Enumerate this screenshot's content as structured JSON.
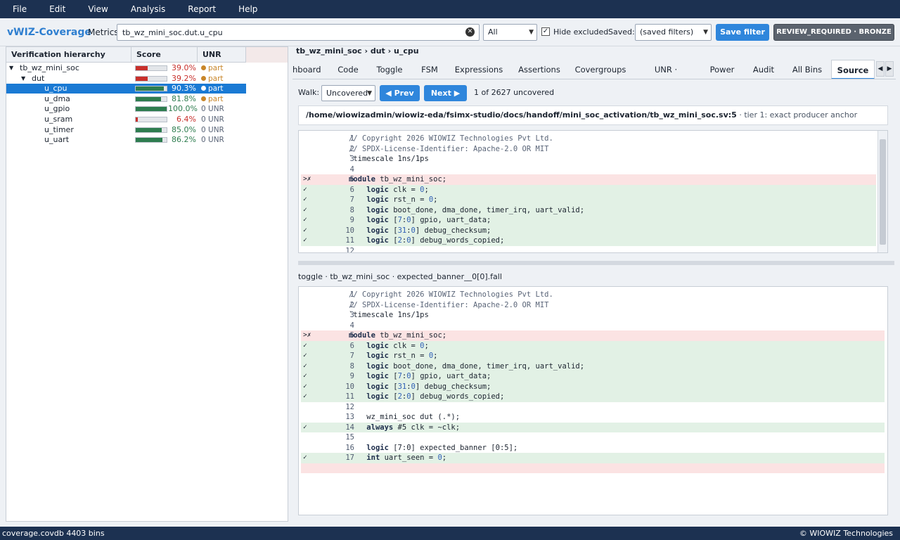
{
  "menu": [
    "File",
    "Edit",
    "View",
    "Analysis",
    "Report",
    "Help"
  ],
  "toolbar": {
    "brand": "vWIZ-Coverage",
    "metrics_label": "Metrics",
    "search_value": "tb_wz_mini_soc.dut.u_cpu",
    "scope_select": "All",
    "hide_excluded_label": "Hide excluded",
    "hide_excluded_checked": "✓",
    "saved_label": "Saved:",
    "saved_select": "(saved filters)",
    "save_filter": "Save filter",
    "status": "REVIEW_REQUIRED · BRONZE"
  },
  "tree": {
    "headers": [
      "Verification hierarchy",
      "Score",
      "UNR"
    ],
    "rows": [
      {
        "name": "tb_wz_mini_soc",
        "pct": "39.0%",
        "value": 0.39,
        "unr": "part",
        "status": "partial"
      },
      {
        "name": "dut",
        "pct": "39.2%",
        "value": 0.392,
        "unr": "part",
        "status": "partial"
      },
      {
        "name": "u_cpu",
        "pct": "90.3%",
        "value": 0.903,
        "unr": "part",
        "status": "partial",
        "selected": true
      },
      {
        "name": "u_dma",
        "pct": "81.8%",
        "value": 0.818,
        "unr": "part",
        "status": "partial"
      },
      {
        "name": "u_gpio",
        "pct": "100.0%",
        "value": 1.0,
        "unr": "0 UNR",
        "status": "none"
      },
      {
        "name": "u_sram",
        "pct": "6.4%",
        "value": 0.064,
        "unr": "0 UNR",
        "status": "none"
      },
      {
        "name": "u_timer",
        "pct": "85.0%",
        "value": 0.85,
        "unr": "0 UNR",
        "status": "none"
      },
      {
        "name": "u_uart",
        "pct": "86.2%",
        "value": 0.862,
        "unr": "0 UNR",
        "status": "none"
      }
    ]
  },
  "breadcrumb": "tb_wz_mini_soc › dut › u_cpu",
  "tabs": [
    "hboard",
    "Code",
    "Toggle",
    "FSM",
    "Expressions",
    "Assertions",
    "Covergroups",
    "UNR · Closure",
    "Power",
    "Audit",
    "All Bins",
    "Source"
  ],
  "active_tab": "Source",
  "walk": {
    "label": "Walk:",
    "mode": "Uncovered",
    "prev": "◀ Prev",
    "next": "Next ▶",
    "count": "1 of 2627 uncovered"
  },
  "source_path": "/home/wiowizadmin/wiowiz-eda/fsimx-studio/docs/handoff/mini_soc_activation/tb_wz_mini_soc.sv:5",
  "source_anchor": " · tier 1: exact producer anchor",
  "lower_title": "toggle · tb_wz_mini_soc · expected_banner__0[0].fall",
  "code_lines": [
    {
      "n": "1",
      "mark": "",
      "status": "none",
      "parts": [
        [
          "cmt",
          "// Copyright 2026 WIOWIZ Technologies Pvt Ltd."
        ]
      ]
    },
    {
      "n": "2",
      "mark": "",
      "status": "none",
      "parts": [
        [
          "cmt",
          "// SPDX-License-Identifier: Apache-2.0 OR MIT"
        ]
      ]
    },
    {
      "n": "3",
      "mark": "",
      "status": "none",
      "parts": [
        [
          "",
          "`timescale 1ns/1ps"
        ]
      ]
    },
    {
      "n": "4",
      "mark": "",
      "status": "none",
      "parts": [
        [
          "",
          ""
        ]
      ]
    },
    {
      "n": "5",
      "mark": ">✗",
      "status": "miss",
      "parts": [
        [
          "kw",
          "module"
        ],
        [
          "",
          " tb_wz_mini_soc;"
        ]
      ]
    },
    {
      "n": "6",
      "mark": "✓",
      "status": "hit",
      "parts": [
        [
          "",
          "    "
        ],
        [
          "kw",
          "logic"
        ],
        [
          "",
          " clk = "
        ],
        [
          "num",
          "0"
        ],
        [
          "",
          ";"
        ]
      ]
    },
    {
      "n": "7",
      "mark": "✓",
      "status": "hit",
      "parts": [
        [
          "",
          "    "
        ],
        [
          "kw",
          "logic"
        ],
        [
          "",
          " rst_n = "
        ],
        [
          "num",
          "0"
        ],
        [
          "",
          ";"
        ]
      ]
    },
    {
      "n": "8",
      "mark": "✓",
      "status": "hit",
      "parts": [
        [
          "",
          "    "
        ],
        [
          "kw",
          "logic"
        ],
        [
          "",
          " boot_done, dma_done, timer_irq, uart_valid;"
        ]
      ]
    },
    {
      "n": "9",
      "mark": "✓",
      "status": "hit",
      "parts": [
        [
          "",
          "    "
        ],
        [
          "kw",
          "logic"
        ],
        [
          "",
          " ["
        ],
        [
          "num",
          "7"
        ],
        [
          "",
          ":"
        ],
        [
          "num",
          "0"
        ],
        [
          "",
          "] gpio, uart_data;"
        ]
      ]
    },
    {
      "n": "10",
      "mark": "✓",
      "status": "hit",
      "parts": [
        [
          "",
          "    "
        ],
        [
          "kw",
          "logic"
        ],
        [
          "",
          " ["
        ],
        [
          "num",
          "31"
        ],
        [
          "",
          ":"
        ],
        [
          "num",
          "0"
        ],
        [
          "",
          "] debug_checksum;"
        ]
      ]
    },
    {
      "n": "11",
      "mark": "✓",
      "status": "hit",
      "parts": [
        [
          "",
          "    "
        ],
        [
          "kw",
          "logic"
        ],
        [
          "",
          " ["
        ],
        [
          "num",
          "2"
        ],
        [
          "",
          ":"
        ],
        [
          "num",
          "0"
        ],
        [
          "",
          "] debug_words_copied;"
        ]
      ]
    },
    {
      "n": "12",
      "mark": "",
      "status": "none",
      "parts": [
        [
          "",
          ""
        ]
      ]
    },
    {
      "n": "13",
      "mark": "",
      "status": "none",
      "parts": [
        [
          "",
          "    wz_mini_soc dut (.*);"
        ]
      ]
    },
    {
      "n": "14",
      "mark": "✓",
      "status": "hit",
      "parts": [
        [
          "",
          "    "
        ],
        [
          "kw",
          "always"
        ],
        [
          "",
          " #5 clk = ~clk;"
        ]
      ]
    },
    {
      "n": "15",
      "mark": "",
      "status": "none",
      "parts": [
        [
          "",
          ""
        ]
      ]
    },
    {
      "n": "16",
      "mark": "",
      "status": "none",
      "parts": [
        [
          "",
          "    "
        ],
        [
          "kw",
          "logic"
        ],
        [
          "",
          " [7:0] expected_banner [0:5];"
        ]
      ]
    },
    {
      "n": "17",
      "mark": "✓",
      "status": "hit",
      "parts": [
        [
          "",
          "    "
        ],
        [
          "kw",
          "int"
        ],
        [
          "",
          " uart_seen = "
        ],
        [
          "num",
          "0"
        ],
        [
          "",
          ";"
        ]
      ]
    }
  ],
  "colors": {
    "good": "#2e7d4f",
    "bad": "#c8302c",
    "warn": "#c8862a",
    "accent": "#2f86dc"
  },
  "statusbar": {
    "left": "coverage.covdb  4403 bins",
    "right": "© WIOWIZ Technologies"
  }
}
